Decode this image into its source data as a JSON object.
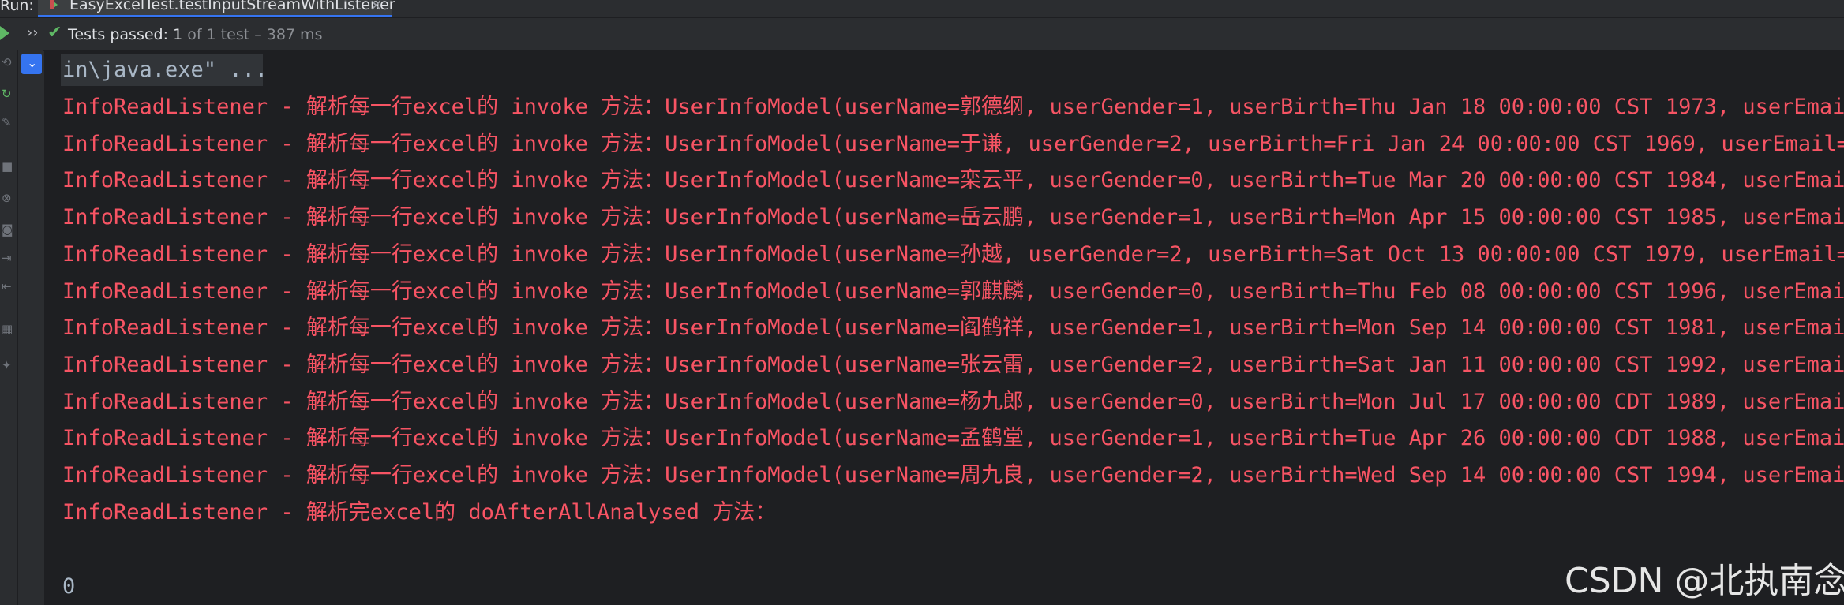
{
  "run_bar": {
    "label": "Run:",
    "tab_title": "EasyExcelTest.testInputStreamWithListener",
    "close_glyph": "×"
  },
  "toolbar": {
    "status_pass": "Tests passed:",
    "status_count": "1",
    "status_detail": "of 1 test – 387 ms"
  },
  "console": {
    "command_tail": "in\\java.exe\" ...",
    "log_lines": [
      "InfoReadListener - 解析每一行excel的 invoke 方法：UserInfoModel(userName=郭德纲, userGender=1, userBirth=Thu Jan 18 00:00:00 CST 1973, userEmail=",
      "InfoReadListener - 解析每一行excel的 invoke 方法：UserInfoModel(userName=于谦, userGender=2, userBirth=Fri Jan 24 00:00:00 CST 1969, userEmail=yu",
      "InfoReadListener - 解析每一行excel的 invoke 方法：UserInfoModel(userName=栾云平, userGender=0, userBirth=Tue Mar 20 00:00:00 CST 1984, userEmail=",
      "InfoReadListener - 解析每一行excel的 invoke 方法：UserInfoModel(userName=岳云鹏, userGender=1, userBirth=Mon Apr 15 00:00:00 CST 1985, userEmail=",
      "InfoReadListener - 解析每一行excel的 invoke 方法：UserInfoModel(userName=孙越, userGender=2, userBirth=Sat Oct 13 00:00:00 CST 1979, userEmail=su",
      "InfoReadListener - 解析每一行excel的 invoke 方法：UserInfoModel(userName=郭麒麟, userGender=0, userBirth=Thu Feb 08 00:00:00 CST 1996, userEmail=",
      "InfoReadListener - 解析每一行excel的 invoke 方法：UserInfoModel(userName=阎鹤祥, userGender=1, userBirth=Mon Sep 14 00:00:00 CST 1981, userEmail=",
      "InfoReadListener - 解析每一行excel的 invoke 方法：UserInfoModel(userName=张云雷, userGender=2, userBirth=Sat Jan 11 00:00:00 CST 1992, userEmail=",
      "InfoReadListener - 解析每一行excel的 invoke 方法：UserInfoModel(userName=杨九郎, userGender=0, userBirth=Mon Jul 17 00:00:00 CDT 1989, userEmail=",
      "InfoReadListener - 解析每一行excel的 invoke 方法：UserInfoModel(userName=孟鹤堂, userGender=1, userBirth=Tue Apr 26 00:00:00 CDT 1988, userEmail=",
      "InfoReadListener - 解析每一行excel的 invoke 方法：UserInfoModel(userName=周九良, userGender=2, userBirth=Wed Sep 14 00:00:00 CST 1994, userEmail=",
      "InfoReadListener - 解析完excel的 doAfterAllAnalysed 方法："
    ],
    "trailing_output": "0"
  },
  "watermark": "CSDN @北执南念",
  "colors": {
    "log_error": "#f75464",
    "pass_green": "#5fb865",
    "accent_blue": "#3574f0"
  },
  "icons": [
    "run-icon",
    "expand-chevron-icon",
    "pass-check-icon",
    "filter-icon",
    "close-icon"
  ]
}
